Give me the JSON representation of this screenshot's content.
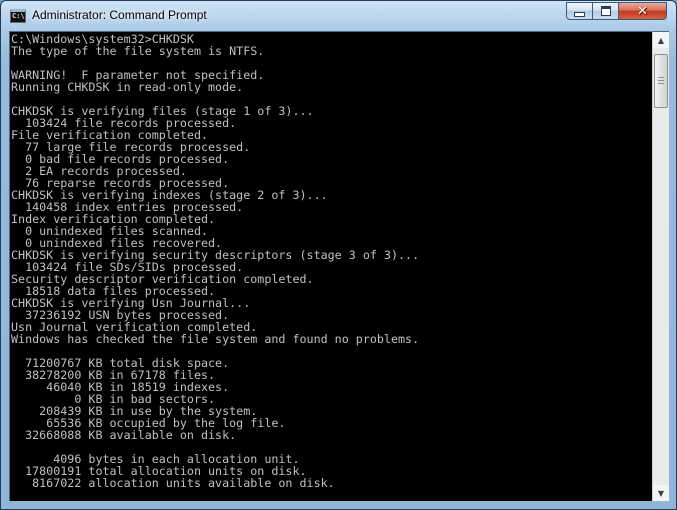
{
  "window": {
    "title": "Administrator: Command Prompt",
    "icon": "cmd-icon",
    "icon_label": "C:\\",
    "close_glyph": "✕"
  },
  "console": {
    "background": "#000000",
    "text_color": "#c0c0c0",
    "lines": [
      "C:\\Windows\\system32>CHKDSK",
      "The type of the file system is NTFS.",
      "",
      "WARNING!  F parameter not specified.",
      "Running CHKDSK in read-only mode.",
      "",
      "CHKDSK is verifying files (stage 1 of 3)...",
      "  103424 file records processed.",
      "File verification completed.",
      "  77 large file records processed.",
      "  0 bad file records processed.",
      "  2 EA records processed.",
      "  76 reparse records processed.",
      "CHKDSK is verifying indexes (stage 2 of 3)...",
      "  140458 index entries processed.",
      "Index verification completed.",
      "  0 unindexed files scanned.",
      "  0 unindexed files recovered.",
      "CHKDSK is verifying security descriptors (stage 3 of 3)...",
      "  103424 file SDs/SIDs processed.",
      "Security descriptor verification completed.",
      "  18518 data files processed.",
      "CHKDSK is verifying Usn Journal...",
      "  37236192 USN bytes processed.",
      "Usn Journal verification completed.",
      "Windows has checked the file system and found no problems.",
      "",
      "  71200767 KB total disk space.",
      "  38278200 KB in 67178 files.",
      "     46040 KB in 18519 indexes.",
      "         0 KB in bad sectors.",
      "    208439 KB in use by the system.",
      "     65536 KB occupied by the log file.",
      "  32668088 KB available on disk.",
      "",
      "      4096 bytes in each allocation unit.",
      "  17800191 total allocation units on disk.",
      "   8167022 allocation units available on disk."
    ]
  },
  "scrollbar": {
    "up_glyph": "▲",
    "down_glyph": "▼"
  }
}
